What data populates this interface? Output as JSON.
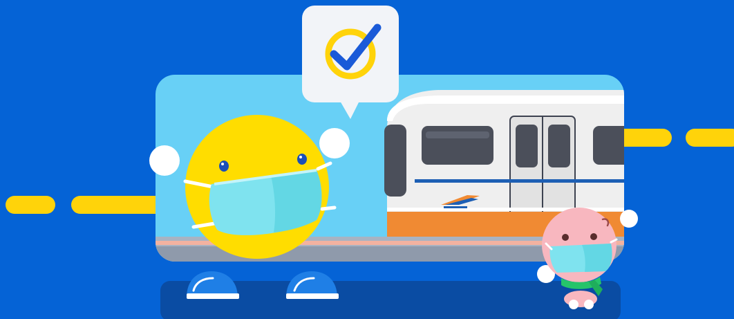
{
  "scene": {
    "type": "illustration",
    "subject": "train-platform-mascots-with-masks",
    "colors": {
      "background": "#0563d6",
      "dash_yellow": "#ffd30a",
      "platform_sky": "#68d0f6",
      "floor_navy": "#0a4ca3",
      "mascot_yellow": "#ffdd00",
      "mask_cyan": "#7fe3ef",
      "train_body": "#efefef",
      "train_window": "#4b4f5a",
      "train_stripe_blue": "#1d5fb4",
      "train_stripe_orange": "#f08a33",
      "check_blue": "#1a5ad8",
      "baby_pink": "#f8b7bf",
      "scarf_green": "#26c46a"
    },
    "icons": {
      "speech_bubble": "checkmark-icon",
      "train_logo": "kai-logo-icon"
    }
  }
}
